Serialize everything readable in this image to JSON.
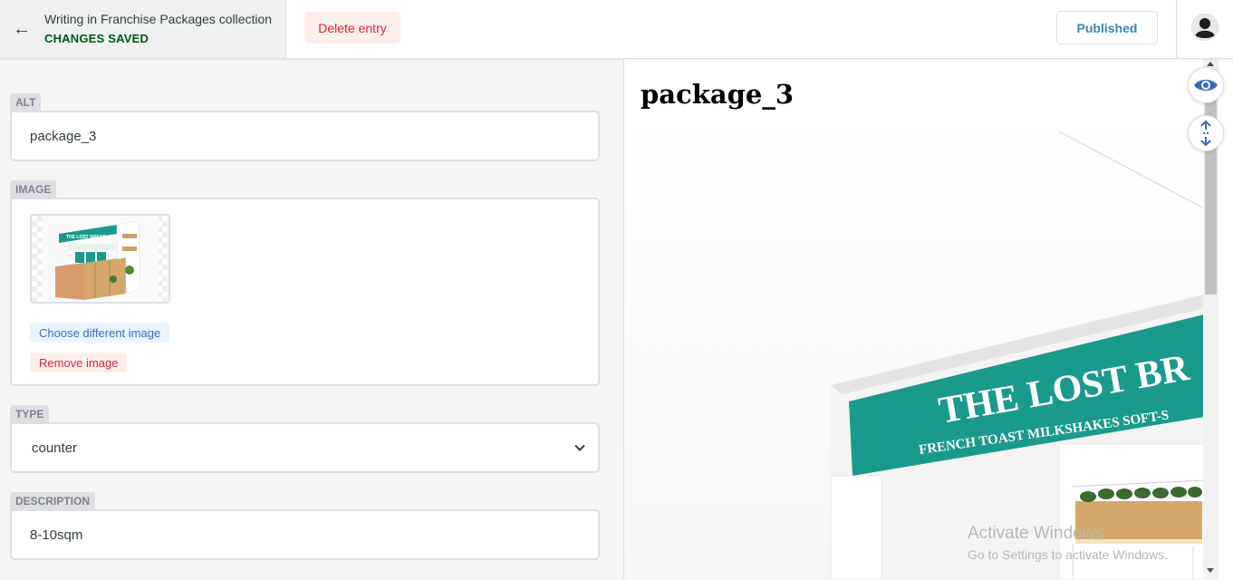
{
  "header": {
    "collection_label": "Writing in Franchise Packages collection",
    "status": "CHANGES SAVED",
    "delete_label": "Delete entry",
    "publish_status": "Published"
  },
  "fields": {
    "alt": {
      "label": "ALT",
      "value": "package_3"
    },
    "image": {
      "label": "IMAGE",
      "choose_label": "Choose different image",
      "remove_label": "Remove image"
    },
    "type": {
      "label": "TYPE",
      "value": "counter"
    },
    "description": {
      "label": "DESCRIPTION",
      "value": "8-10sqm"
    }
  },
  "preview": {
    "title": "package_3",
    "sign_main": "THE LOST BR",
    "sign_sub": "FRENCH TOAST MILKSHAKES SOFT-S"
  },
  "watermark": {
    "line1": "Activate Windows",
    "line2": "Go to Settings to activate Windows."
  },
  "colors": {
    "teal": "#1a9a8c",
    "wood": "#d4a86a",
    "danger": "#d9243d",
    "saved": "#005614"
  },
  "icons": [
    "back-arrow-icon",
    "user-avatar-icon",
    "chevron-down-icon",
    "eye-icon",
    "scroll-sync-icon"
  ]
}
